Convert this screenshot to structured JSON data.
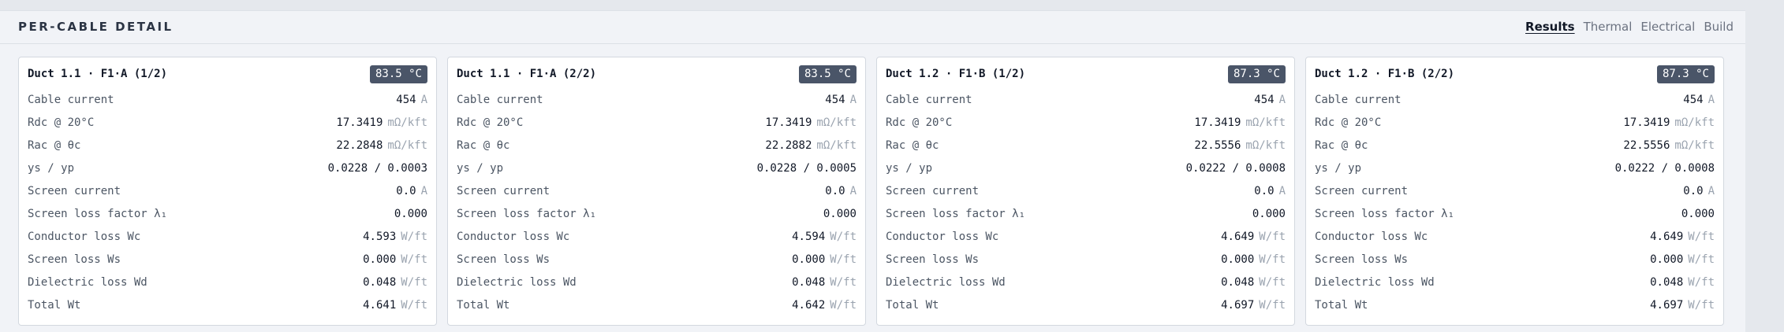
{
  "panel": {
    "title": "PER-CABLE DETAIL",
    "tabs": [
      {
        "label": "Results",
        "active": true
      },
      {
        "label": "Thermal",
        "active": false
      },
      {
        "label": "Electrical",
        "active": false
      },
      {
        "label": "Build",
        "active": false
      }
    ]
  },
  "labels": {
    "cable_current": "Cable current",
    "rdc": "Rdc @ 20°C",
    "rac": "Rac @ θc",
    "ys_yp": "ys / yp",
    "screen_current": "Screen current",
    "screen_loss_factor": "Screen loss factor λ₁",
    "conductor_loss": "Conductor loss Wc",
    "screen_loss": "Screen loss Ws",
    "dielectric_loss": "Dielectric loss Wd",
    "total": "Total Wt"
  },
  "units": {
    "current": "A",
    "resistance": "mΩ/kft",
    "power": "W/ft"
  },
  "cards": [
    {
      "title": "Duct 1.1 · F1·A (1/2)",
      "temp": "83.5 °C",
      "cable_current": "454",
      "rdc": "17.3419",
      "rac": "22.2848",
      "ys_yp": "0.0228 / 0.0003",
      "screen_current": "0.0",
      "screen_loss_factor": "0.000",
      "conductor_loss": "4.593",
      "screen_loss": "0.000",
      "dielectric_loss": "0.048",
      "total": "4.641"
    },
    {
      "title": "Duct 1.1 · F1·A (2/2)",
      "temp": "83.5 °C",
      "cable_current": "454",
      "rdc": "17.3419",
      "rac": "22.2882",
      "ys_yp": "0.0228 / 0.0005",
      "screen_current": "0.0",
      "screen_loss_factor": "0.000",
      "conductor_loss": "4.594",
      "screen_loss": "0.000",
      "dielectric_loss": "0.048",
      "total": "4.642"
    },
    {
      "title": "Duct 1.2 · F1·B (1/2)",
      "temp": "87.3 °C",
      "cable_current": "454",
      "rdc": "17.3419",
      "rac": "22.5556",
      "ys_yp": "0.0222 / 0.0008",
      "screen_current": "0.0",
      "screen_loss_factor": "0.000",
      "conductor_loss": "4.649",
      "screen_loss": "0.000",
      "dielectric_loss": "0.048",
      "total": "4.697"
    },
    {
      "title": "Duct 1.2 · F1·B (2/2)",
      "temp": "87.3 °C",
      "cable_current": "454",
      "rdc": "17.3419",
      "rac": "22.5556",
      "ys_yp": "0.0222 / 0.0008",
      "screen_current": "0.0",
      "screen_loss_factor": "0.000",
      "conductor_loss": "4.649",
      "screen_loss": "0.000",
      "dielectric_loss": "0.048",
      "total": "4.697"
    }
  ]
}
